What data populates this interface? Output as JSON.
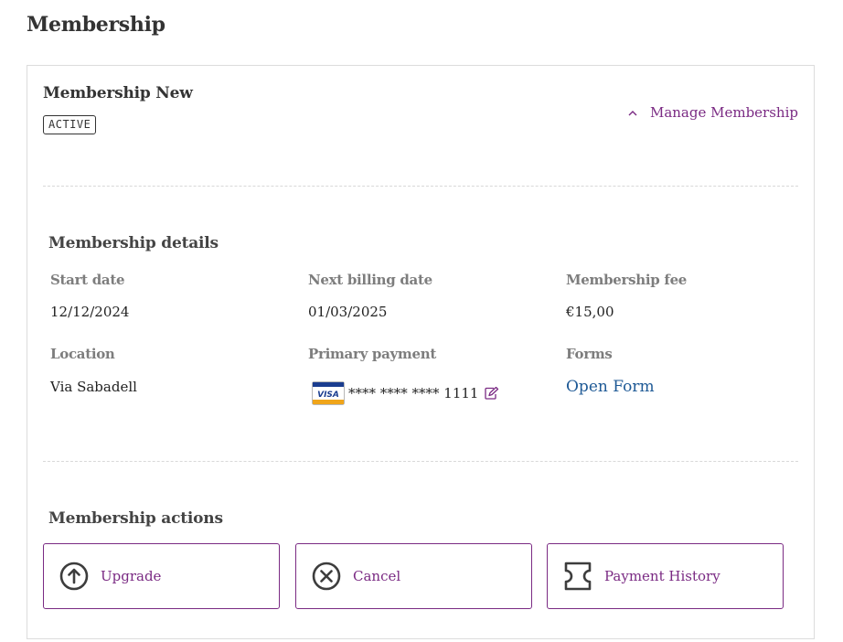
{
  "page": {
    "title": "Membership"
  },
  "membership": {
    "name": "Membership New",
    "status": "ACTIVE",
    "manage_label": "Manage Membership"
  },
  "details": {
    "title": "Membership details",
    "start_date": {
      "label": "Start date",
      "value": "12/12/2024"
    },
    "next_billing": {
      "label": "Next billing date",
      "value": "01/03/2025"
    },
    "fee": {
      "label": "Membership fee",
      "value": "€15,00"
    },
    "location": {
      "label": "Location",
      "value": "Via Sabadell"
    },
    "payment": {
      "label": "Primary payment",
      "card_brand": "VISA",
      "card_number": "**** **** **** 1111"
    },
    "forms": {
      "label": "Forms",
      "link": "Open Form"
    }
  },
  "actions": {
    "title": "Membership actions",
    "buttons": [
      {
        "label": "Upgrade",
        "icon": "arrow-up-circle-icon"
      },
      {
        "label": "Cancel",
        "icon": "x-circle-icon"
      },
      {
        "label": "Payment History",
        "icon": "receipt-icon"
      }
    ]
  },
  "colors": {
    "accent": "#7a2a83",
    "link": "#1f5a96",
    "text": "#333333",
    "label": "#7d7d7d"
  }
}
